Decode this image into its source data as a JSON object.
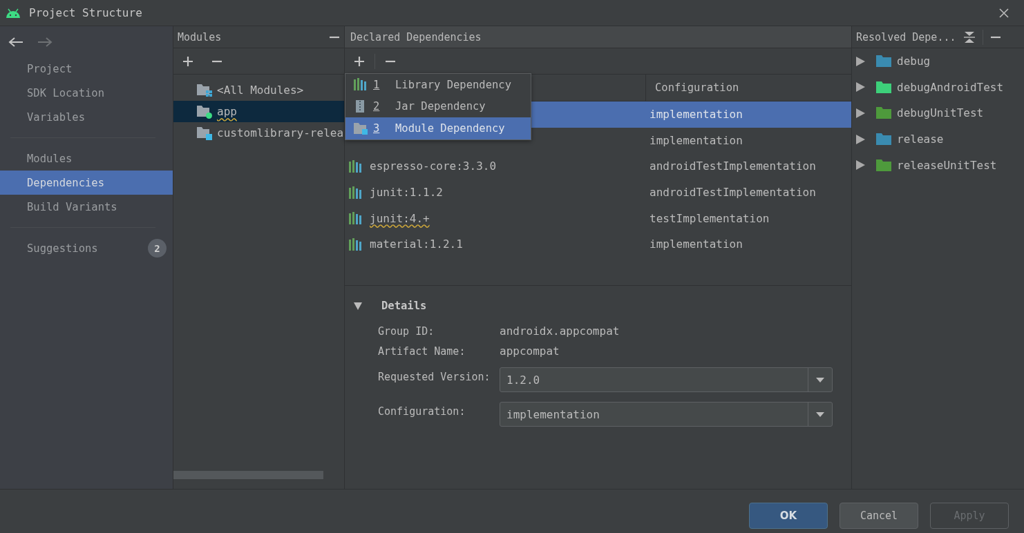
{
  "window": {
    "title": "Project Structure"
  },
  "sidebar": {
    "groups": [
      [
        {
          "label": "Project",
          "selected": false
        },
        {
          "label": "SDK Location",
          "selected": false
        },
        {
          "label": "Variables",
          "selected": false
        }
      ],
      [
        {
          "label": "Modules",
          "selected": false
        },
        {
          "label": "Dependencies",
          "selected": true
        },
        {
          "label": "Build Variants",
          "selected": false
        }
      ],
      [
        {
          "label": "Suggestions",
          "selected": false,
          "badge": "2"
        }
      ]
    ]
  },
  "modules": {
    "title": "Modules",
    "items": [
      {
        "label": "<All Modules>",
        "kind": "all",
        "selected": false
      },
      {
        "label": "app",
        "kind": "app",
        "selected": true
      },
      {
        "label": "customlibrary-relea",
        "kind": "library",
        "selected": false
      }
    ]
  },
  "declared": {
    "title": "Declared Dependencies",
    "columns": [
      "Configuration"
    ],
    "rows": [
      {
        "configuration": "implementation",
        "selected": true
      },
      {
        "configuration": "implementation",
        "selected": false
      },
      {
        "name": "espresso-core:3.3.0",
        "configuration": "androidTestImplementation",
        "selected": false
      },
      {
        "name": "junit:1.1.2",
        "configuration": "androidTestImplementation",
        "selected": false
      },
      {
        "name": "junit:4.+",
        "configuration": "testImplementation",
        "selected": false
      },
      {
        "name": "material:1.2.1",
        "configuration": "implementation",
        "selected": false
      }
    ],
    "add_menu": [
      {
        "key": "1",
        "label": "Library Dependency",
        "kind": "library",
        "selected": false
      },
      {
        "key": "2",
        "label": "Jar Dependency",
        "kind": "jar",
        "selected": false
      },
      {
        "key": "3",
        "label": "Module Dependency",
        "kind": "module",
        "selected": true
      }
    ],
    "details": {
      "title": "Details",
      "expanded": true,
      "fields": [
        {
          "label": "Group ID:",
          "value": "androidx.appcompat",
          "kind": "text"
        },
        {
          "label": "Artifact Name:",
          "value": "appcompat",
          "kind": "text"
        },
        {
          "label": "Requested Version:",
          "value": "1.2.0",
          "kind": "combo"
        },
        {
          "label": "Configuration:",
          "value": "implementation",
          "kind": "combo"
        }
      ]
    }
  },
  "resolved": {
    "title": "Resolved Depe...",
    "items": [
      {
        "label": "debug",
        "color": "#3a8bb0"
      },
      {
        "label": "debugAndroidTest",
        "color": "#3dd07a"
      },
      {
        "label": "debugUnitTest",
        "color": "#4e9a3c"
      },
      {
        "label": "release",
        "color": "#3a8bb0"
      },
      {
        "label": "releaseUnitTest",
        "color": "#4e9a3c"
      }
    ]
  },
  "buttons": [
    {
      "label": "OK",
      "kind": "default",
      "disabled": false
    },
    {
      "label": "Cancel",
      "kind": "normal",
      "disabled": false
    },
    {
      "label": "Apply",
      "kind": "normal",
      "disabled": true
    }
  ]
}
